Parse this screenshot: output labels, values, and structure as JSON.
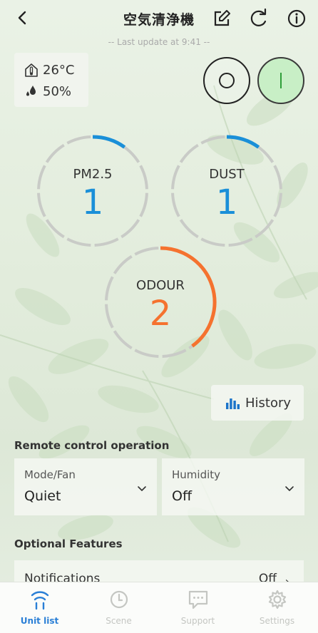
{
  "header": {
    "title": "空気清浄機",
    "back_icon": "chevron-left-icon",
    "edit_icon": "edit-icon",
    "refresh_icon": "refresh-icon",
    "info_icon": "info-icon"
  },
  "last_update": "-- Last update at 9:41 --",
  "environment": {
    "temperature": "26°C",
    "humidity": "50%"
  },
  "power": {
    "off_label_icon": "power-off-icon",
    "on_label_icon": "power-on-icon"
  },
  "gauges": [
    {
      "label": "PM2.5",
      "value": "1",
      "level": 0.1,
      "color": "#1a8fd8"
    },
    {
      "label": "DUST",
      "value": "1",
      "level": 0.1,
      "color": "#1a8fd8"
    },
    {
      "label": "ODOUR",
      "value": "2",
      "level": 0.4,
      "color": "#f5722f"
    }
  ],
  "history_label": "History",
  "remote_control": {
    "title": "Remote control operation",
    "mode": {
      "label": "Mode/Fan",
      "value": "Quiet"
    },
    "humidity": {
      "label": "Humidity",
      "value": "Off"
    }
  },
  "optional": {
    "title": "Optional Features",
    "notifications": {
      "label": "Notifications",
      "value": "Off"
    }
  },
  "tabs": [
    {
      "label": "Unit list",
      "icon": "unit-list-icon",
      "active": true
    },
    {
      "label": "Scene",
      "icon": "clock-icon",
      "active": false
    },
    {
      "label": "Support",
      "icon": "chat-icon",
      "active": false
    },
    {
      "label": "Settings",
      "icon": "gear-icon",
      "active": false
    }
  ],
  "colors": {
    "accent": "#1a8fd8",
    "odour": "#f5722f",
    "power_on": "#2f9e3a",
    "tab_active": "#2a7fd6"
  }
}
